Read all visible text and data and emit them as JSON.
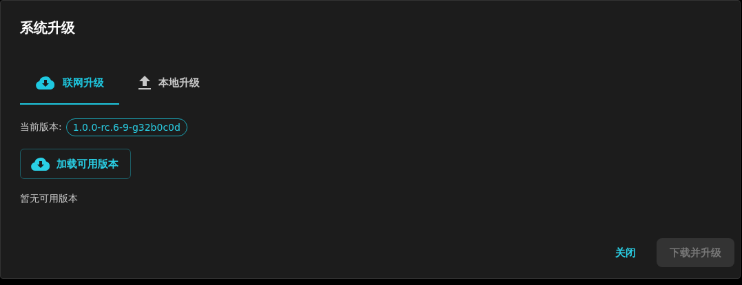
{
  "dialog": {
    "title": "系统升级"
  },
  "tabs": [
    {
      "label": "联网升级",
      "kind": "online",
      "selected": true
    },
    {
      "label": "本地升级",
      "kind": "local",
      "selected": false
    }
  ],
  "current_version": {
    "label": "当前版本:",
    "value": "1.0.0-rc.6-9-g32b0c0d"
  },
  "load_button": {
    "label": "加载可用版本"
  },
  "status_text": "暂无可用版本",
  "footer": {
    "close_button": {
      "label": "关闭"
    },
    "upgrade_button": {
      "label": "下载并升级",
      "disabled": true
    }
  }
}
